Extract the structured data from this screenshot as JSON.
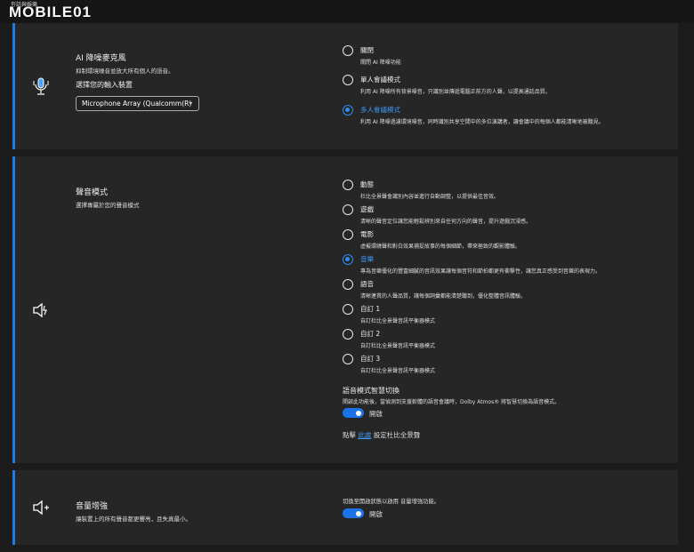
{
  "logo": {
    "text": "MOBILE01",
    "tagline": "夯話與娛樂"
  },
  "noise_mic": {
    "title": "AI 降噪麥克風",
    "subtitle": "抑制環境噪音並放大所有個人的語音。",
    "device_label": "選擇您的輸入裝置",
    "device_value": "Microphone Array (Qualcomm(R)",
    "options": [
      {
        "label": "關閉",
        "desc": "關閉 AI 降噪功能",
        "selected": false
      },
      {
        "label": "單人會議模式",
        "desc": "利用 AI 降噪所有背景噪音，只識別並傳遞電腦正前方的人聲，以提高通話品質。",
        "selected": false
      },
      {
        "label": "多人會議模式",
        "desc": "利用 AI 降噪過濾環境噪音，同時識別共享空間中的多位演講者，讓會議中的每個人都能清晰地被聽見。",
        "selected": true
      }
    ]
  },
  "sound_mode": {
    "title": "聲音模式",
    "subtitle": "選擇專屬於您的聲音模式",
    "options": [
      {
        "label": "動態",
        "desc": "杜比全景聲會識別內容並進行自動調整，以提供最佳音效。",
        "selected": false
      },
      {
        "label": "遊戲",
        "desc": "清晰的聲音定位讓您能輕鬆辨別來自任何方向的聲音，提升遊戲沉浸感。",
        "selected": false
      },
      {
        "label": "電影",
        "desc": "虛擬環繞聲和對白效果捕捉故事的每個細節，帶來極致的觀影體驗。",
        "selected": false
      },
      {
        "label": "音樂",
        "desc": "專為音樂優化的豐富細膩的音訊效果讓每個音符和節拍都更有衝擊性，讓您真正感受到音樂的表現力。",
        "selected": true
      },
      {
        "label": "語音",
        "desc": "清晰連貫的人聲品質，讓每個詞彙都能清楚聽到，優化整體音訊體驗。",
        "selected": false
      },
      {
        "label": "自訂 1",
        "desc": "自訂杜比全景聲音訊平衡器模式",
        "selected": false
      },
      {
        "label": "自訂 2",
        "desc": "自訂杜比全景聲音訊平衡器模式",
        "selected": false
      },
      {
        "label": "自訂 3",
        "desc": "自訂杜比全景聲音訊平衡器模式",
        "selected": false
      }
    ],
    "smart_switch": {
      "title": "語音模式智慧切換",
      "desc": "開啟此功能後，當偵測到支援軟體的語音會議時，Dolby Atmos® 將智慧切換為語音模式。",
      "toggle_label": "開啟",
      "on": true
    },
    "link_prefix": "點擊",
    "link_text": "此處",
    "link_suffix": "設定杜比全景聲"
  },
  "volume_boost": {
    "title": "音量增強",
    "subtitle": "讓裝置上的所有聲音都更響亮，且失真最小。",
    "hint": "切換至開啟狀態以啟用 音量增強功能。",
    "toggle_label": "開啟",
    "on": true
  },
  "colors": {
    "accent": "#1d7ce6",
    "panel": "#262626",
    "background": "#1c1c1c"
  }
}
